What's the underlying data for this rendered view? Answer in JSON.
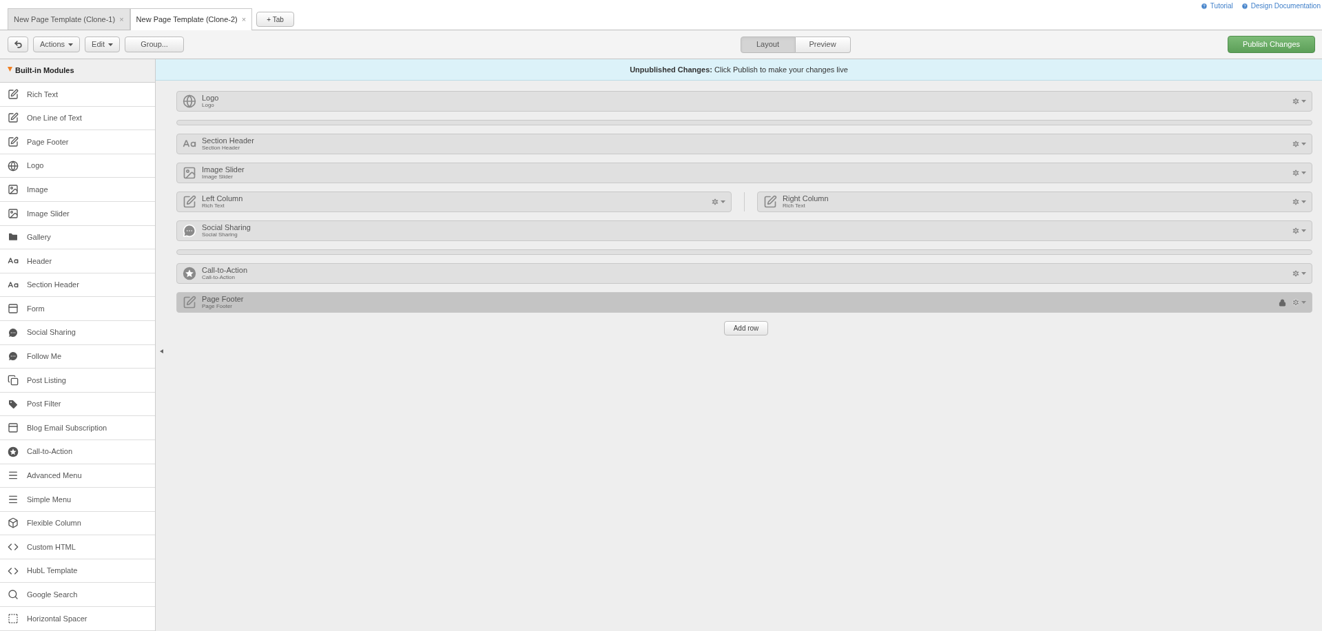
{
  "tabs": [
    {
      "label": "New Page Template (Clone-1)",
      "close": "×",
      "selected": false
    },
    {
      "label": "New Page Template (Clone-2)",
      "close": "×",
      "selected": true
    }
  ],
  "add_tab_button": "+ Tab",
  "help_links": [
    "Tutorial",
    "Design Documentation"
  ],
  "toolbar": {
    "menus": [
      "Actions",
      "Edit"
    ],
    "group_button": "Group...",
    "view_toggle": [
      {
        "label": "Layout",
        "selected": true
      },
      {
        "label": "Preview",
        "selected": false
      }
    ],
    "publish_button": "Publish Changes"
  },
  "sidebar": {
    "title": "Built-in Modules",
    "expanded": true,
    "items": [
      {
        "label": "Rich Text",
        "kind": "edit"
      },
      {
        "label": "One Line of Text",
        "kind": "edit"
      },
      {
        "label": "Page Footer",
        "kind": "edit"
      },
      {
        "label": "Logo",
        "kind": "globe"
      },
      {
        "label": "Image",
        "kind": "image"
      },
      {
        "label": "Image Slider",
        "kind": "image"
      },
      {
        "label": "Gallery",
        "kind": "folder"
      },
      {
        "label": "Header",
        "kind": "text"
      },
      {
        "label": "Section Header",
        "kind": "text"
      },
      {
        "label": "Form",
        "kind": "form"
      },
      {
        "label": "Social Sharing",
        "kind": "chat"
      },
      {
        "label": "Follow Me",
        "kind": "chat"
      },
      {
        "label": "Post Listing",
        "kind": "listing"
      },
      {
        "label": "Post Filter",
        "kind": "tag"
      },
      {
        "label": "Blog Email Subscription",
        "kind": "form"
      },
      {
        "label": "Call-to-Action",
        "kind": "star"
      },
      {
        "label": "Advanced Menu",
        "kind": "menu"
      },
      {
        "label": "Simple Menu",
        "kind": "menu"
      },
      {
        "label": "Flexible Column",
        "kind": "box"
      },
      {
        "label": "Custom HTML",
        "kind": "code"
      },
      {
        "label": "HubL Template",
        "kind": "code"
      },
      {
        "label": "Google Search",
        "kind": "search"
      },
      {
        "label": "Horizontal Spacer",
        "kind": "dashed"
      }
    ]
  },
  "banner": {
    "bold": "Unpublished Changes:",
    "text": "Click Publish to make your changes live"
  },
  "rows": [
    {
      "kind": "module",
      "modules": [
        {
          "title": "Logo",
          "subtitle": "Logo",
          "kind": "globe",
          "locked": false
        }
      ]
    },
    {
      "kind": "spacer"
    },
    {
      "kind": "module",
      "modules": [
        {
          "title": "Section Header",
          "subtitle": "Section Header",
          "kind": "text",
          "locked": false
        }
      ]
    },
    {
      "kind": "module",
      "modules": [
        {
          "title": "Image Slider",
          "subtitle": "Image Slider",
          "kind": "image",
          "locked": false
        }
      ]
    },
    {
      "kind": "module",
      "modules": [
        {
          "title": "Left Column",
          "subtitle": "Rich Text",
          "kind": "edit",
          "locked": false
        },
        {
          "title": "Right Column",
          "subtitle": "Rich Text",
          "kind": "edit",
          "locked": false
        }
      ]
    },
    {
      "kind": "module",
      "modules": [
        {
          "title": "Social Sharing",
          "subtitle": "Social Sharing",
          "kind": "chat",
          "locked": false
        }
      ]
    },
    {
      "kind": "spacer"
    },
    {
      "kind": "module",
      "modules": [
        {
          "title": "Call-to-Action",
          "subtitle": "Call-to-Action",
          "kind": "star",
          "locked": false
        }
      ]
    },
    {
      "kind": "module",
      "modules": [
        {
          "title": "Page Footer",
          "subtitle": "Page Footer",
          "kind": "edit",
          "locked": true
        }
      ]
    }
  ],
  "add_row_button": "Add row"
}
